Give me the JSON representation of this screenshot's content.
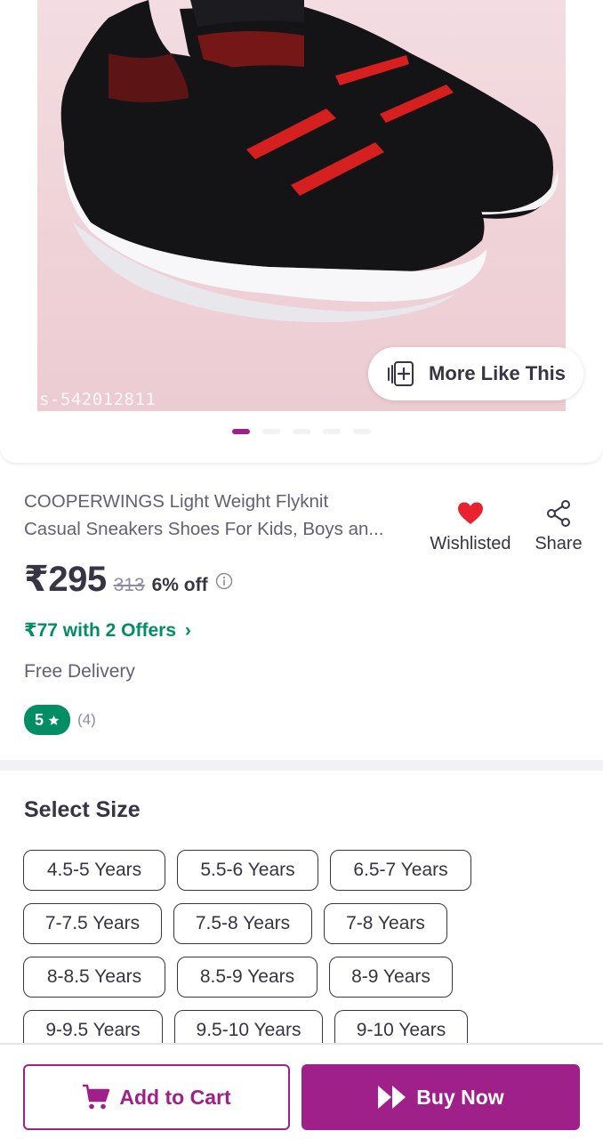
{
  "product_image": {
    "watermark": "s-542012811",
    "more_like_this_label": "More Like This",
    "carousel_dots": 5,
    "active_dot": 0
  },
  "product": {
    "title_line1": "COOPERWINGS Light Weight Flyknit",
    "title_line2": "Casual Sneakers Shoes For Kids, Boys an...",
    "price": "₹295",
    "mrp": "313",
    "discount": "6% off",
    "offers_text": "₹77 with 2 Offers",
    "delivery": "Free Delivery",
    "rating": "5",
    "rating_count": "(4)"
  },
  "actions": {
    "wishlist_label": "Wishlisted",
    "share_label": "Share"
  },
  "size_section": {
    "title": "Select Size",
    "sizes": [
      "4.5-5 Years",
      "5.5-6 Years",
      "6.5-7 Years",
      "7-7.5 Years",
      "7.5-8 Years",
      "7-8 Years",
      "8-8.5 Years",
      "8.5-9 Years",
      "8-9 Years",
      "9-9.5 Years",
      "9.5-10 Years",
      "9-10 Years"
    ]
  },
  "bottom_bar": {
    "add_to_cart_label": "Add to Cart",
    "buy_now_label": "Buy Now"
  },
  "colors": {
    "brand_purple": "#9f2089",
    "offer_green": "#038d63",
    "wishlist_red": "#e8232f"
  }
}
